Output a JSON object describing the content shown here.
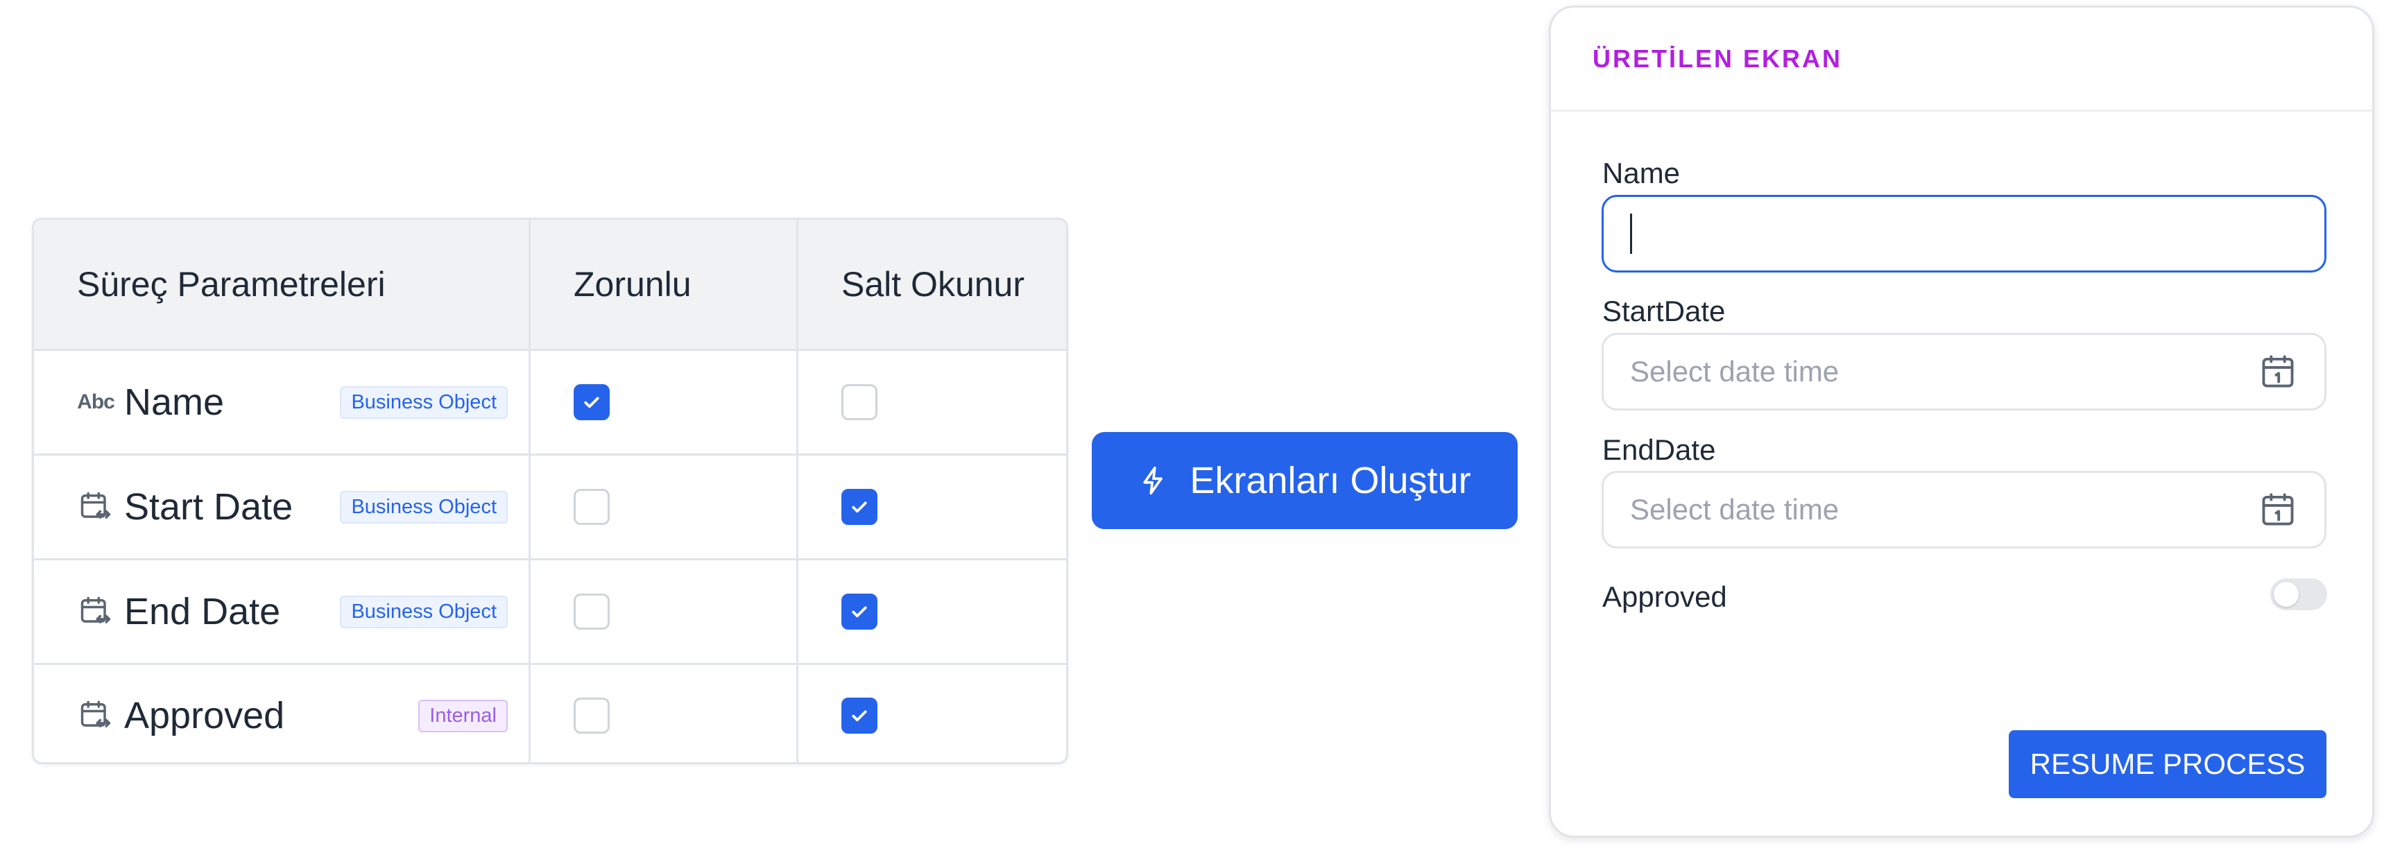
{
  "table": {
    "headers": [
      "Süreç Parametreleri",
      "Zorunlu",
      "Salt Okunur"
    ],
    "rows": [
      {
        "icon": "text-abc-icon",
        "icon_text": "Abc",
        "name": "Name",
        "tag": "Business Object",
        "tag_kind": "business-object",
        "required": true,
        "readonly": false
      },
      {
        "icon": "calendar-range-icon",
        "name": "Start Date",
        "tag": "Business Object",
        "tag_kind": "business-object",
        "required": false,
        "readonly": true
      },
      {
        "icon": "calendar-range-icon",
        "name": "End Date",
        "tag": "Business Object",
        "tag_kind": "business-object",
        "required": false,
        "readonly": true
      },
      {
        "icon": "calendar-range-icon",
        "name": "Approved",
        "tag": "Internal",
        "tag_kind": "internal",
        "required": false,
        "readonly": true
      }
    ]
  },
  "generate_button": {
    "label": "Ekranları Oluştur",
    "icon": "lightning-bolt-icon"
  },
  "panel": {
    "title": "ÜRETİLEN EKRAN",
    "fields": [
      {
        "label": "Name",
        "value": "",
        "placeholder": ""
      },
      {
        "label": "StartDate",
        "placeholder": "Select date time"
      },
      {
        "label": "EndDate",
        "placeholder": "Select date time"
      }
    ],
    "approved": {
      "label": "Approved",
      "on": false
    },
    "resume_button": "RESUME PROCESS"
  },
  "colors": {
    "accent": "#2563eb",
    "panel_title": "#b11fe0",
    "tag_business_object": "#2563eb",
    "tag_internal": "#9b5de5"
  }
}
